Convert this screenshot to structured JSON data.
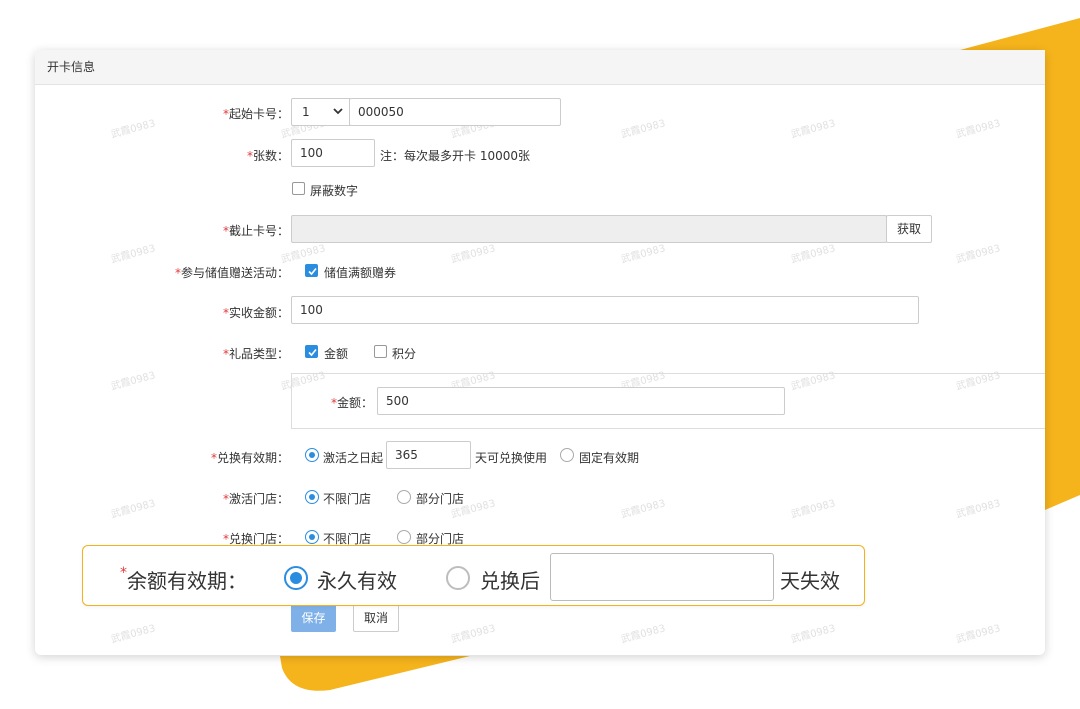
{
  "card": {
    "title": "开卡信息"
  },
  "watermark": "武霞0983",
  "colors": {
    "accent": "#2b8de0",
    "required": "#e4393c",
    "brand_yellow": "#f6b41c"
  },
  "form": {
    "start_card": {
      "label": "起始卡号：",
      "select_value": "1",
      "input_value": "000050"
    },
    "count": {
      "label": "张数：",
      "value": "100",
      "note": "注：每次最多开卡 10000张"
    },
    "mask_digits": {
      "label": "屏蔽数字",
      "checked": false
    },
    "end_card": {
      "label": "截止卡号：",
      "value": "",
      "fetch_button": "获取"
    },
    "promo": {
      "label": "参与储值赠送活动：",
      "option": "储值满额赠券",
      "checked": true
    },
    "received_amount": {
      "label": "实收金额：",
      "value": "100"
    },
    "gift_type": {
      "label": "礼品类型：",
      "options": [
        {
          "label": "金额",
          "checked": true
        },
        {
          "label": "积分",
          "checked": false
        }
      ],
      "amount_label": "金额：",
      "amount_value": "500"
    },
    "redeem_validity": {
      "label": "兑换有效期：",
      "option1": "激活之日起",
      "days_value": "365",
      "suffix": "天可兑换使用",
      "option2": "固定有效期",
      "selected": "option1"
    },
    "activation_store": {
      "label": "激活门店：",
      "option1": "不限门店",
      "option2": "部分门店",
      "selected": "option1"
    },
    "redeem_store": {
      "label": "兑换门店：",
      "option1": "不限门店",
      "option2": "部分门店",
      "selected": "option1"
    }
  },
  "buttons": {
    "save": "保存",
    "cancel": "取消"
  },
  "callout": {
    "label": "余额有效期：",
    "option1": "永久有效",
    "option2": "兑换后",
    "input_value": "",
    "suffix": "天失效",
    "selected": "option1"
  }
}
